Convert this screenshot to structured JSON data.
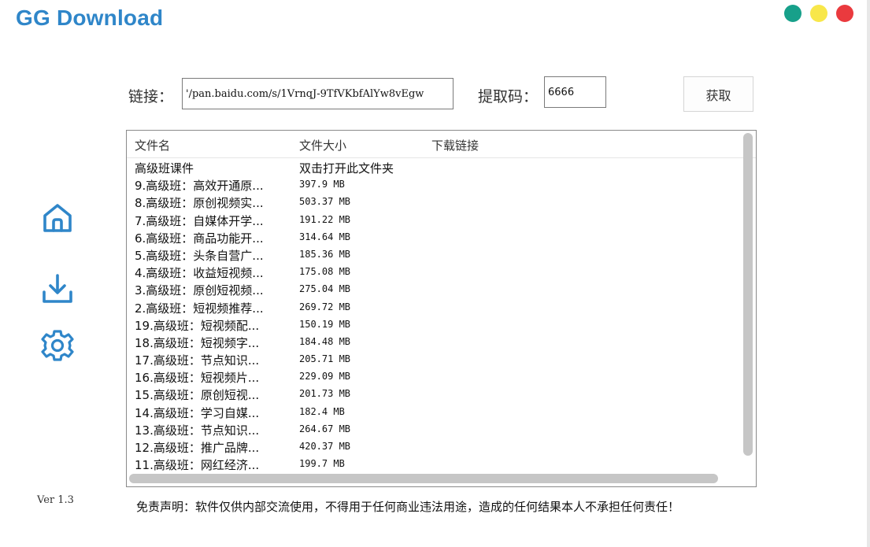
{
  "app": {
    "title": "GG Download",
    "version": "Ver 1.3"
  },
  "window_controls": {
    "colors": [
      "#17a08a",
      "#f8e74a",
      "#ea3a3e"
    ]
  },
  "sidebar": {
    "icons": [
      "home-icon",
      "download-icon",
      "settings-gear-icon"
    ],
    "accent_color": "#2f86c9"
  },
  "form": {
    "link_label": "链接：",
    "link_value": "'/pan.baidu.com/s/1VrnqJ-9TfVKbfAlYw8vEgw",
    "code_label": "提取码：",
    "code_value": "6666",
    "fetch_label": "获取"
  },
  "file_list": {
    "headers": [
      "文件名",
      "文件大小",
      "下载链接"
    ],
    "rows": [
      {
        "name": "高级班课件",
        "size": "双击打开此文件夹"
      },
      {
        "name": "9.高级班：高效开通原...",
        "size": "397.9 MB"
      },
      {
        "name": "8.高级班：原创视频实...",
        "size": "503.37 MB"
      },
      {
        "name": "7.高级班：自媒体开学...",
        "size": "191.22 MB"
      },
      {
        "name": "6.高级班：商品功能开...",
        "size": "314.64 MB"
      },
      {
        "name": "5.高级班：头条自营广...",
        "size": "185.36 MB"
      },
      {
        "name": "4.高级班：收益短视频...",
        "size": "175.08 MB"
      },
      {
        "name": "3.高级班：原创短视频...",
        "size": "275.04 MB"
      },
      {
        "name": "2.高级班：短视频推荐...",
        "size": "269.72 MB"
      },
      {
        "name": "19.高级班：短视频配...",
        "size": "150.19 MB"
      },
      {
        "name": "18.高级班：短视频字...",
        "size": "184.48 MB"
      },
      {
        "name": "17.高级班：节点知识...",
        "size": "205.71 MB"
      },
      {
        "name": "16.高级班：短视频片...",
        "size": "229.09 MB"
      },
      {
        "name": "15.高级班：原创短视...",
        "size": "201.73 MB"
      },
      {
        "name": "14.高级班：学习自媒...",
        "size": "182.4 MB"
      },
      {
        "name": "13.高级班：节点知识...",
        "size": "264.67 MB"
      },
      {
        "name": "12.高级班：推广品牌...",
        "size": "420.37 MB"
      },
      {
        "name": "11.高级班：网红经济...",
        "size": "199.7 MB"
      }
    ]
  },
  "footer": {
    "disclaimer": "免责声明：软件仅供内部交流使用，不得用于任何商业违法用途，造成的任何结果本人不承担任何责任！"
  }
}
